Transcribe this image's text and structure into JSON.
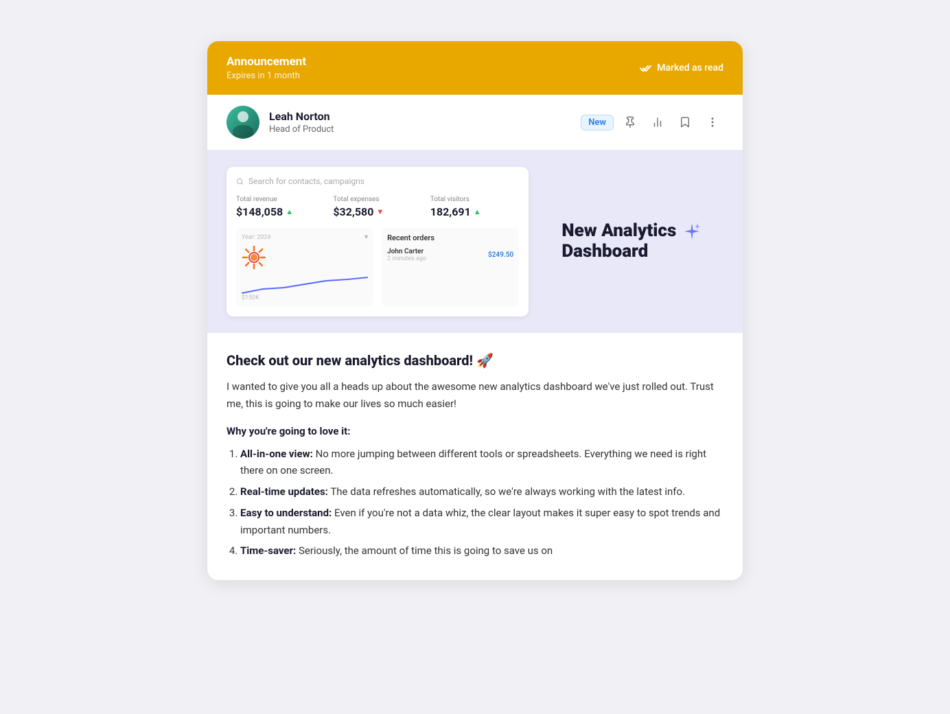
{
  "header": {
    "title": "Announcement",
    "subtitle": "Expires in 1 month",
    "marked_read": "Marked as read"
  },
  "author": {
    "name": "Leah Norton",
    "role": "Head of Product",
    "badge": "New"
  },
  "preview": {
    "search_placeholder": "Search for contacts, campaigns",
    "stats": [
      {
        "label": "Total revenue",
        "value": "$148,058",
        "trend": "up"
      },
      {
        "label": "Total expenses",
        "value": "$32,580",
        "trend": "down"
      },
      {
        "label": "Total visitors",
        "value": "182,691",
        "trend": "up"
      }
    ],
    "chart_year": "Year: 2024",
    "chart_label": "$150K",
    "orders_title": "Recent orders",
    "order_name": "John Carter",
    "order_time": "2 minutes ago",
    "order_amount": "$249.50",
    "right_title": "New Analytics\nDashboard"
  },
  "content": {
    "title": "Check out our new analytics dashboard! 🚀",
    "body": "I wanted to give you all a heads up about the awesome new analytics dashboard we've just rolled out. Trust me, this is going to make our lives so much easier!",
    "why_title": "Why you're going to love it:",
    "features": [
      {
        "bold": "All-in-one view:",
        "text": " No more jumping between different tools or spreadsheets. Everything we need is right there on one screen."
      },
      {
        "bold": "Real-time updates:",
        "text": " The data refreshes automatically, so we're always working with the latest info."
      },
      {
        "bold": "Easy to understand:",
        "text": " Even if you're not a data whiz, the clear layout makes it super easy to spot trends and important numbers."
      },
      {
        "bold": "Time-saver:",
        "text": " Seriously, the amount of time this is going to save us on"
      }
    ]
  }
}
